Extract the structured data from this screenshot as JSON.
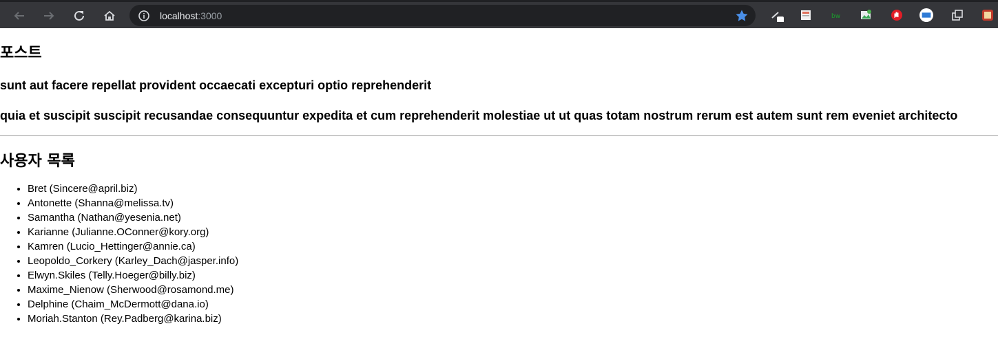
{
  "browser": {
    "url_host": "localhost",
    "url_port": ":3000"
  },
  "page": {
    "post_heading": "포스트",
    "post_title": "sunt aut facere repellat provident occaecati excepturi optio reprehenderit",
    "post_body": "quia et suscipit suscipit recusandae consequuntur expedita et cum reprehenderit molestiae ut ut quas totam nostrum rerum est autem sunt rem eveniet architecto",
    "users_heading": "사용자 목록",
    "users": [
      "Bret (Sincere@april.biz)",
      "Antonette (Shanna@melissa.tv)",
      "Samantha (Nathan@yesenia.net)",
      "Karianne (Julianne.OConner@kory.org)",
      "Kamren (Lucio_Hettinger@annie.ca)",
      "Leopoldo_Corkery (Karley_Dach@jasper.info)",
      "Elwyn.Skiles (Telly.Hoeger@billy.biz)",
      "Maxime_Nienow (Sherwood@rosamond.me)",
      "Delphine (Chaim_McDermott@dana.io)",
      "Moriah.Stanton (Rey.Padberg@karina.biz)"
    ]
  },
  "colors": {
    "toolbar_bg": "#35363a",
    "omnibox_bg": "#202124",
    "star": "#4a8fe8"
  }
}
